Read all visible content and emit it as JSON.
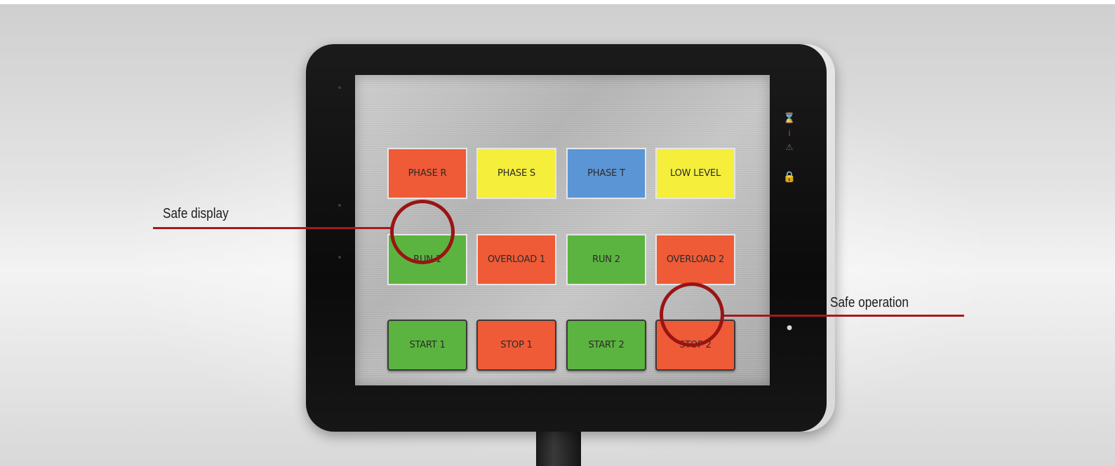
{
  "panel": {
    "rows": [
      [
        {
          "label": "PHASE R",
          "color": "#ef5a37",
          "kind": "indicator"
        },
        {
          "label": "PHASE S",
          "color": "#f5ee3a",
          "kind": "indicator"
        },
        {
          "label": "PHASE T",
          "color": "#5b95d6",
          "kind": "indicator"
        },
        {
          "label": "LOW LEVEL",
          "color": "#f5ee3a",
          "kind": "indicator"
        }
      ],
      [
        {
          "label": "RUN 1",
          "color": "#5bb43f",
          "kind": "indicator"
        },
        {
          "label": "OVERLOAD 1",
          "color": "#ef5a37",
          "kind": "indicator"
        },
        {
          "label": "RUN 2",
          "color": "#5bb43f",
          "kind": "indicator"
        },
        {
          "label": "OVERLOAD 2",
          "color": "#ef5a37",
          "kind": "indicator"
        }
      ],
      [
        {
          "label": "START 1",
          "color": "#5bb43f",
          "kind": "button"
        },
        {
          "label": "STOP 1",
          "color": "#ef5a37",
          "kind": "button"
        },
        {
          "label": "START 2",
          "color": "#5bb43f",
          "kind": "button"
        },
        {
          "label": "STOP 2",
          "color": "#ef5a37",
          "kind": "button"
        }
      ]
    ]
  },
  "status_icons": [
    {
      "icon": "hourglass-icon",
      "glyph": "⌛",
      "color": "#e03a2a"
    },
    {
      "icon": "info-icon",
      "glyph": "i",
      "color": "#e03a2a"
    },
    {
      "icon": "warning-icon",
      "glyph": "⚠",
      "color": "#6b6b6b"
    },
    {
      "icon": "lock-icon",
      "glyph": "🔒",
      "color": "#f2cc1c"
    },
    {
      "icon": "power-dot-icon",
      "glyph": "●",
      "color": "#d8d8d8"
    }
  ],
  "annotations": {
    "safe_display": "Safe display",
    "safe_operation": "Safe operation",
    "accent_color": "#a61a1a"
  }
}
